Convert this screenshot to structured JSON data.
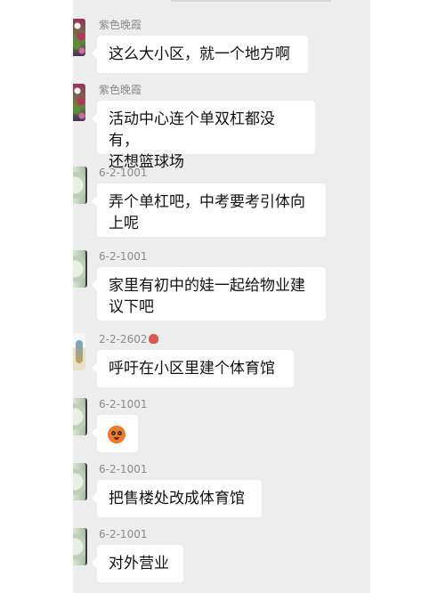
{
  "messages": [
    {
      "sender": "紫色晚霞",
      "text": "这么大小区，就一个地方啊",
      "avatar_icon": "flower-avatar"
    },
    {
      "sender": "紫色晚霞",
      "text": "活动中心连个单双杠都没有，\n还想篮球场",
      "avatar_icon": "flower-avatar"
    },
    {
      "sender": "6-2-1001",
      "text": "弄个单杠吧，中考要考引体向\n上呢",
      "avatar_icon": "pattern-avatar"
    },
    {
      "sender": "6-2-1001",
      "text": "家里有初中的娃一起给物业建\n议下吧",
      "avatar_icon": "pattern-avatar"
    },
    {
      "sender": "2-2-2602",
      "sender_emoji_icon": "octopus-icon",
      "text": "呼吁在小区里建个体育馆",
      "avatar_icon": "figure-avatar"
    },
    {
      "sender": "6-2-1001",
      "emoji_icon": "orange-face-emoji",
      "avatar_icon": "pattern-avatar"
    },
    {
      "sender": "6-2-1001",
      "text": "把售楼处改成体育馆",
      "avatar_icon": "pattern-avatar"
    },
    {
      "sender": "6-2-1001",
      "text": "对外营业",
      "avatar_icon": "pattern-avatar"
    }
  ]
}
